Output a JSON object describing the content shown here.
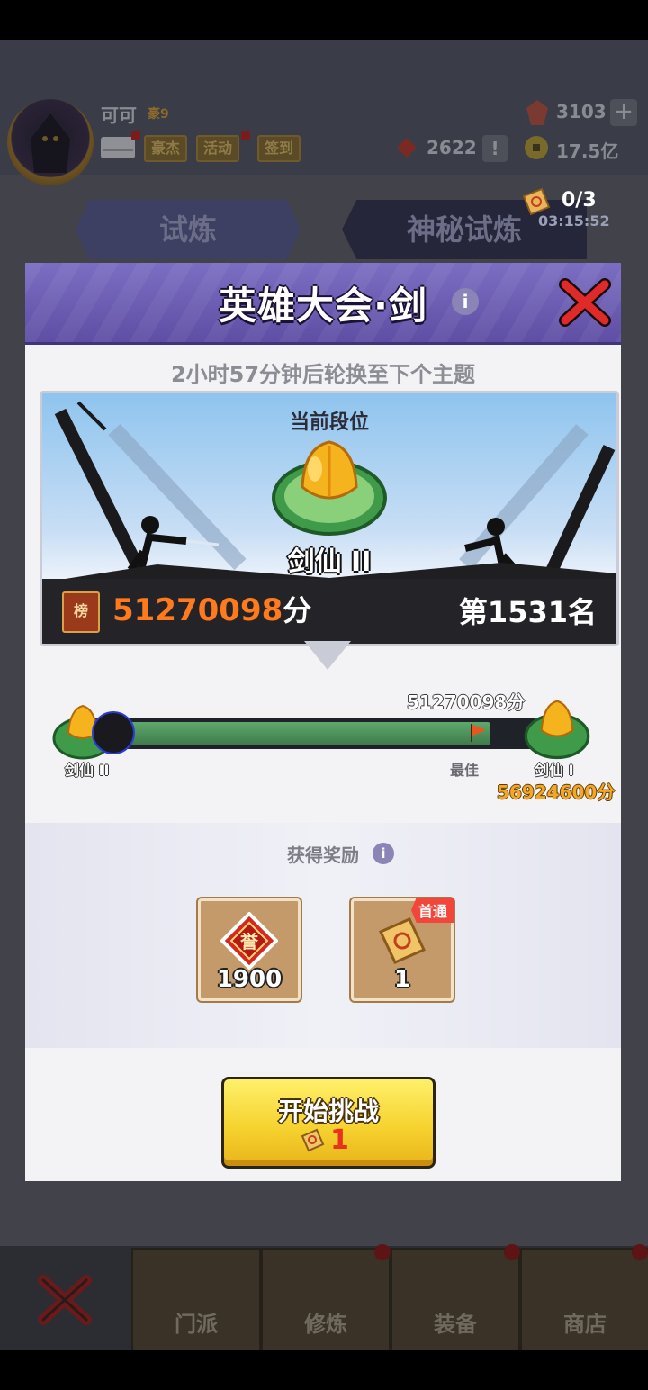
{
  "header": {
    "player_name": "可可",
    "vip": "豪9",
    "tags": [
      "豪杰",
      "活动",
      "签到"
    ],
    "gems": "3103",
    "honor": "2622",
    "coins": "17.5亿"
  },
  "tabs": {
    "trial": "试炼",
    "mystery_trial": "神秘试炼"
  },
  "ticket_counter": {
    "count": "0/3",
    "timer": "03:15:52"
  },
  "modal": {
    "title": "英雄大会·剑",
    "rotate_notice": "2小时57分钟后轮换至下个主题",
    "current_rank_label": "当前段位",
    "current_rank": "剑仙 II",
    "board_icon": "榜",
    "score": "51270098",
    "score_unit": "分",
    "rank_position": "第1531名",
    "progress": {
      "current_score_label": "51270098分",
      "left_tier": "剑仙 II",
      "best_label": "最佳",
      "right_tier": "剑仙 I",
      "next_score": "56924600分",
      "fraction": 0.9
    },
    "rewards_title": "获得奖励",
    "rewards": [
      {
        "icon": "honor-token-icon",
        "count": "1900"
      },
      {
        "icon": "challenge-ticket-icon",
        "count": "1",
        "badge": "首通"
      }
    ],
    "start_button": {
      "label": "开始挑战",
      "cost": "1"
    }
  },
  "bottom_nav": [
    "门派",
    "修炼",
    "装备",
    "商店"
  ],
  "colors": {
    "accent_orange": "#ff7a1c",
    "header_purple": "#6b5bb4",
    "button_yellow": "#f6d330"
  }
}
